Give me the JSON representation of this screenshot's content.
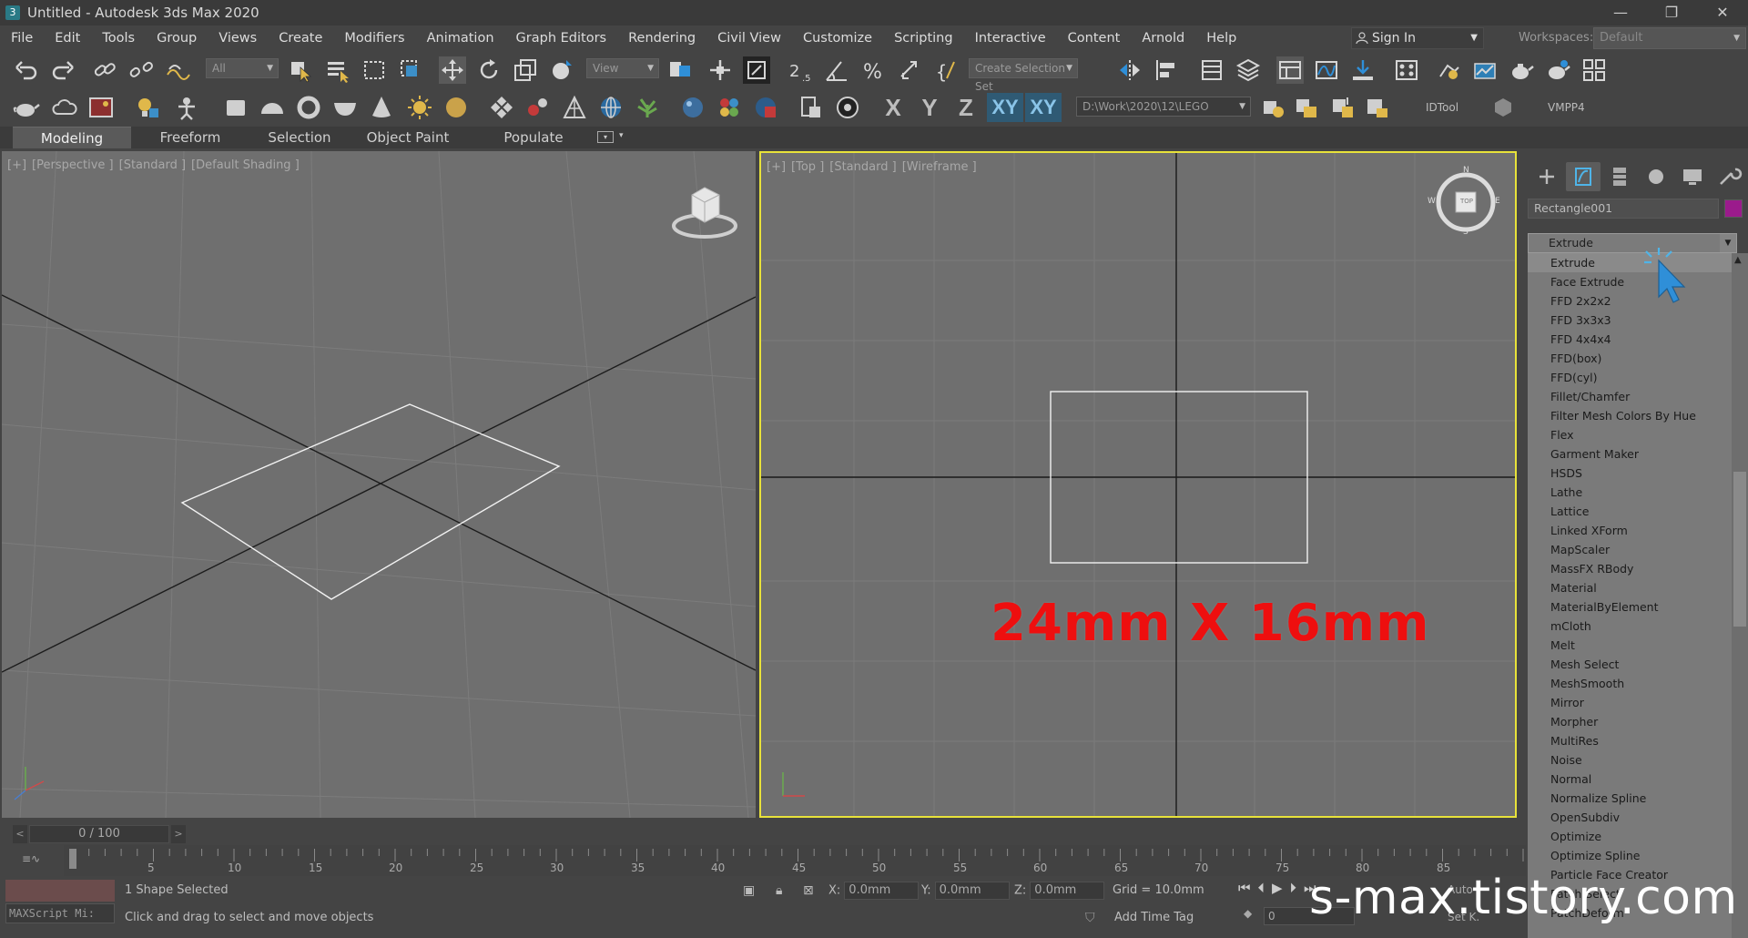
{
  "window": {
    "title": "Untitled - Autodesk 3ds Max 2020",
    "app_icon_text": "3",
    "min": "—",
    "restore": "❐",
    "close": "✕"
  },
  "menu": [
    "File",
    "Edit",
    "Tools",
    "Group",
    "Views",
    "Create",
    "Modifiers",
    "Animation",
    "Graph Editors",
    "Rendering",
    "Civil View",
    "Customize",
    "Scripting",
    "Interactive",
    "Content",
    "Arnold",
    "Help"
  ],
  "account": {
    "sign_in": "Sign In",
    "workspaces_label": "Workspaces:",
    "workspace": "Default"
  },
  "toolbar": {
    "filter": "All",
    "ref_coord": "View",
    "selection_set": "Create Selection Set",
    "axis_x": "X",
    "axis_y": "Y",
    "axis_z": "Z",
    "axis_xy": "XY",
    "axis_xy2": "XY",
    "project_path": "D:\\Work\\2020\\12\\LEGO",
    "idtool": "IDTool",
    "vmpp": "VMPP4"
  },
  "ribbon_tabs": [
    "Modeling",
    "Freeform",
    "Selection",
    "Object Paint",
    "Populate"
  ],
  "viewports": {
    "left": {
      "labels": [
        "[+]",
        "[Perspective ]",
        "[Standard ]",
        "[Default Shading ]"
      ]
    },
    "right": {
      "labels": [
        "[+]",
        "[Top ]",
        "[Standard ]",
        "[Wireframe ]"
      ],
      "viewcube_label": "TOP",
      "compass": {
        "n": "N",
        "s": "S",
        "e": "E",
        "w": "W"
      }
    }
  },
  "annotation": "24mm X 16mm",
  "command_panel": {
    "object_name": "Rectangle001",
    "object_color": "#9b1b8c",
    "modifier_list_value": "Extrude",
    "modifier_list": [
      "Extrude",
      "Face Extrude",
      "FFD 2x2x2",
      "FFD 3x3x3",
      "FFD 4x4x4",
      "FFD(box)",
      "FFD(cyl)",
      "Fillet/Chamfer",
      "Filter Mesh Colors By Hue",
      "Flex",
      "Garment Maker",
      "HSDS",
      "Lathe",
      "Lattice",
      "Linked XForm",
      "MapScaler",
      "MassFX RBody",
      "Material",
      "MaterialByElement",
      "mCloth",
      "Melt",
      "Mesh Select",
      "MeshSmooth",
      "Mirror",
      "Morpher",
      "MultiRes",
      "Noise",
      "Normal",
      "Normalize Spline",
      "OpenSubdiv",
      "Optimize",
      "Optimize Spline",
      "Particle Face Creator",
      "Patch Select",
      "PatchDeform"
    ]
  },
  "timeline": {
    "frame": "0 / 100",
    "prev": "<",
    "next": ">",
    "ticks": [
      "5",
      "10",
      "15",
      "20",
      "25",
      "30",
      "35",
      "40",
      "45",
      "50",
      "55",
      "60",
      "65",
      "70",
      "75",
      "80",
      "85",
      "90"
    ]
  },
  "status": {
    "maxscript": "MAXScript Mi:",
    "selected": "1 Shape Selected",
    "prompt": "Click and drag to select and move objects",
    "x_label": "X:",
    "x": "0.0mm",
    "y_label": "Y:",
    "y": "0.0mm",
    "z_label": "Z:",
    "z": "0.0mm",
    "grid": "Grid = 10.0mm",
    "add_time_tag": "Add Time Tag",
    "frame_field": "0",
    "auto_label": "Auto",
    "setk_label": "Set K."
  },
  "watermark": "s-max.tistory.com",
  "colors": {
    "accent_blue": "#2f8fd8",
    "active_viewport_border": "#e8e23a",
    "annotation_red": "#ee0f0f"
  }
}
